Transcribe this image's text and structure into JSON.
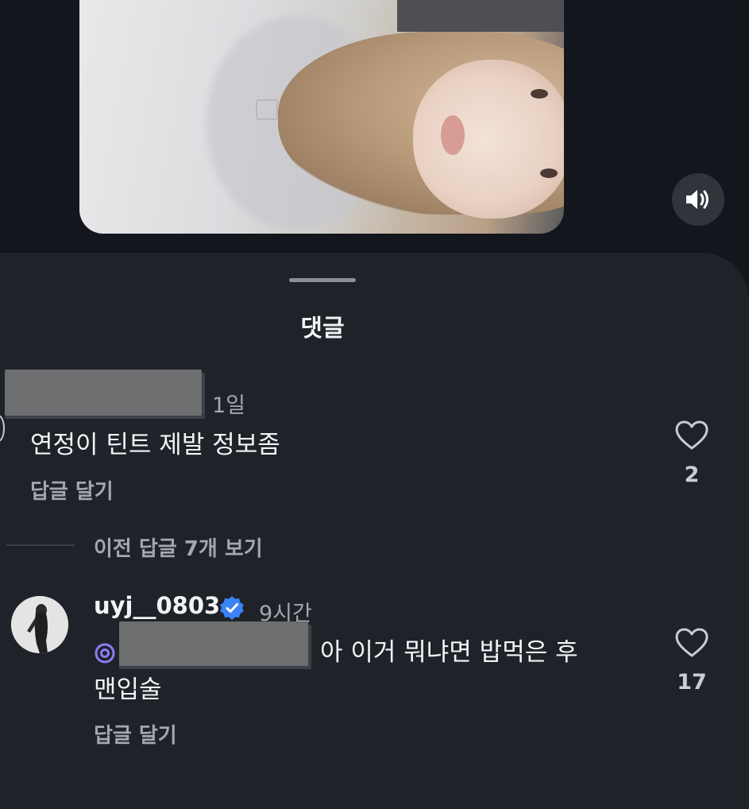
{
  "sheet": {
    "title": "댓글"
  },
  "comments": [
    {
      "time": "1일",
      "text": "연정이 틴트 제발 정보좀",
      "reply_label": "답글 달기",
      "likes": "2"
    }
  ],
  "thread": {
    "view_previous_label": "이전 답글 7개 보기"
  },
  "replies": [
    {
      "username": "uyj__0803",
      "verified": true,
      "time": "9시간",
      "text_line1": "아 이거 뭐냐면 밥먹은 후",
      "text_line2": "맨입술",
      "reply_label": "답글 달기",
      "likes": "17"
    }
  ],
  "colors": {
    "background": "#13161c",
    "sheet": "#1f2229",
    "verified_badge": "#3b82f6",
    "mention_icon": "#8b7cf6"
  },
  "icons": [
    "volume-icon",
    "heart-icon",
    "verified-badge-icon",
    "threads-mention-icon"
  ]
}
